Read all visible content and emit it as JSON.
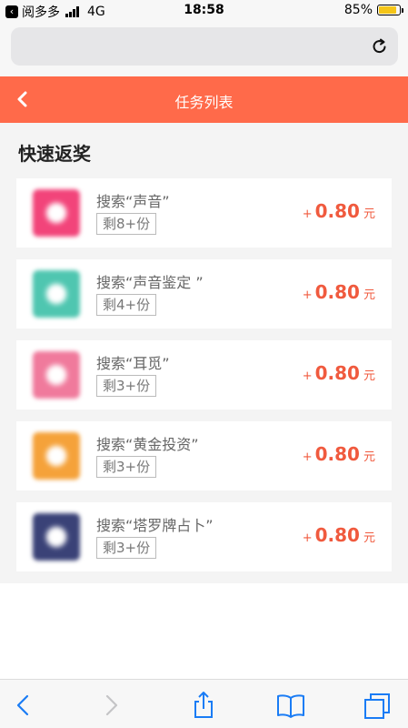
{
  "status_bar": {
    "back_app_label": "阅多多",
    "network": "4G",
    "time": "18:58",
    "battery_percent": "85%",
    "battery_level": 0.85,
    "battery_color": "#f5c518"
  },
  "browser": {
    "reload_icon": "reload-icon"
  },
  "header": {
    "title": "任务列表",
    "back_icon": "chevron-left-icon",
    "color": "#ff6a4a"
  },
  "section": {
    "title": "快速返奖"
  },
  "tasks": [
    {
      "name": "搜索“声音”",
      "remain": "剩8+份",
      "plus": "+",
      "amount": "0.80",
      "unit": "元",
      "thumb_color": "#f2447a"
    },
    {
      "name": "搜索“声音鉴定 ”",
      "remain": "剩4+份",
      "plus": "+",
      "amount": "0.80",
      "unit": "元",
      "thumb_color": "#4fc6b0"
    },
    {
      "name": "搜索“耳觅”",
      "remain": "剩3+份",
      "plus": "+",
      "amount": "0.80",
      "unit": "元",
      "thumb_color": "#f07a9c"
    },
    {
      "name": "搜索“黄金投资”",
      "remain": "剩3+份",
      "plus": "+",
      "amount": "0.80",
      "unit": "元",
      "thumb_color": "#f5a23a"
    },
    {
      "name": "搜索“塔罗牌占卜”",
      "remain": "剩3+份",
      "plus": "+",
      "amount": "0.80",
      "unit": "元",
      "thumb_color": "#3a4277"
    }
  ],
  "toolbar": {
    "icons": [
      "back-arrow-icon",
      "forward-arrow-icon",
      "share-icon",
      "bookmarks-icon",
      "tabs-icon"
    ],
    "accent": "#1a7cf5"
  }
}
